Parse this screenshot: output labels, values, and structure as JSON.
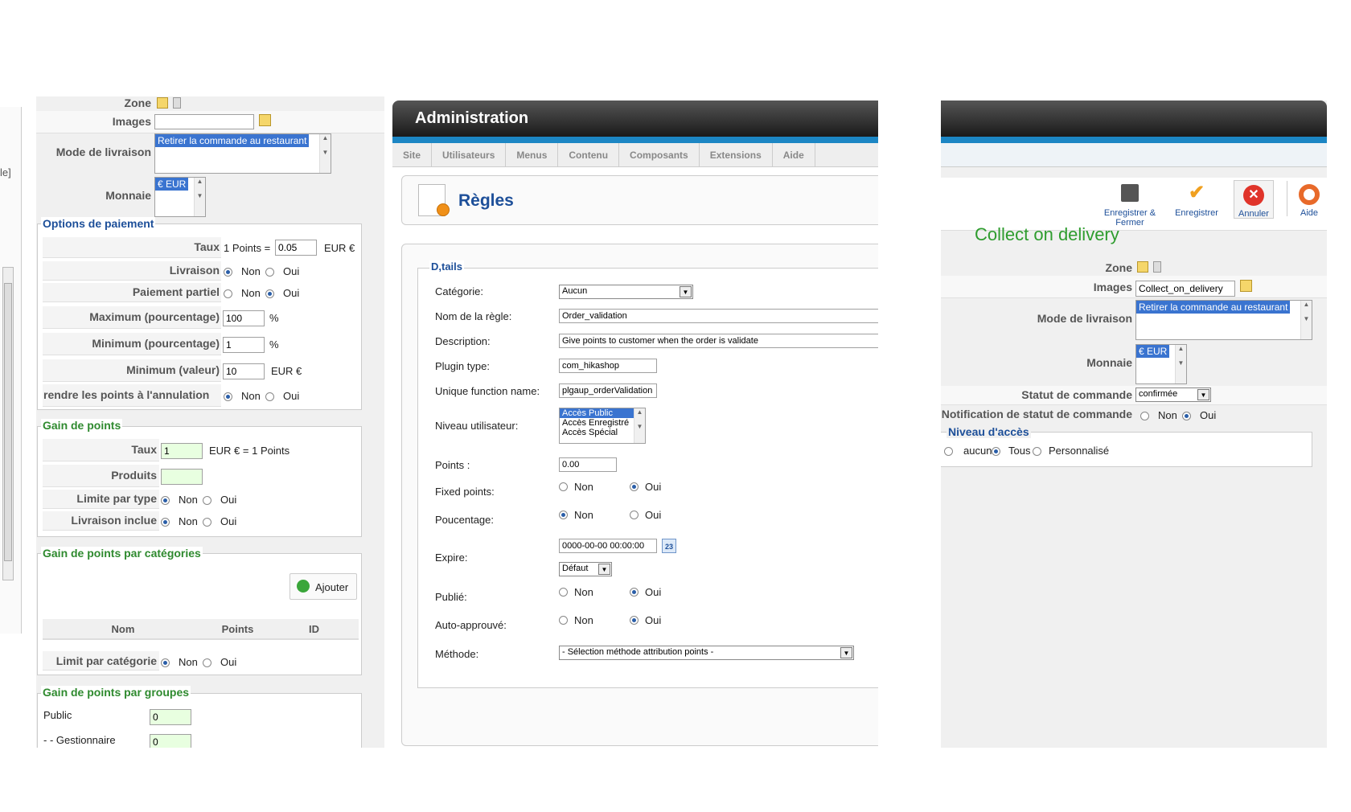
{
  "left": {
    "cut_text": "le]",
    "zone_label": "Zone",
    "images_label": "Images",
    "delivery_label": "Mode de livraison",
    "delivery_value": "Retirer la commande au restaurant",
    "currency_label": "Monnaie",
    "currency_value": "€ EUR",
    "payment": {
      "legend": "Options de paiement",
      "rate_label": "Taux",
      "rate_prefix": "1 Points =",
      "rate_value": "0.05",
      "rate_unit": "EUR €",
      "delivery_label": "Livraison",
      "partial_label": "Paiement partiel",
      "max_label": "Maximum (pourcentage)",
      "max_value": "100",
      "min_label": "Minimum (pourcentage)",
      "min_value": "1",
      "minval_label": "Minimum (valeur)",
      "minval_value": "10",
      "unit_pct": "%",
      "unit_eur": "EUR €",
      "refund_label": "rendre les points à l'annulation"
    },
    "gain": {
      "legend": "Gain de points",
      "rate_label": "Taux",
      "rate_value": "1",
      "rate_suffix": "EUR € = 1 Points",
      "products_label": "Produits",
      "limit_type_label": "Limite par type",
      "delivery_incl_label": "Livraison inclue"
    },
    "gain_cat": {
      "legend": "Gain de points par catégories",
      "add_label": "Ajouter",
      "col_name": "Nom",
      "col_points": "Points",
      "col_id": "ID",
      "limit_label": "Limit par catégorie"
    },
    "gain_groups": {
      "legend": "Gain de points par groupes",
      "public_label": "Public",
      "public_value": "0",
      "manager_label": "- - Gestionnaire",
      "manager_value": "0"
    },
    "non": "Non",
    "oui": "Oui"
  },
  "mid": {
    "header": "Administration",
    "tabs": [
      "Site",
      "Utilisateurs",
      "Menus",
      "Contenu",
      "Composants",
      "Extensions",
      "Aide"
    ],
    "title": "Règles",
    "legend": "D,tails",
    "category_label": "Catégorie:",
    "category_value": "Aucun",
    "name_label": "Nom de la règle:",
    "name_value": "Order_validation",
    "desc_label": "Description:",
    "desc_value": "Give points to customer when the order is validate",
    "plugin_label": "Plugin type:",
    "plugin_value": "com_hikashop",
    "func_label": "Unique function name:",
    "func_value": "plgaup_orderValidation",
    "level_label": "Niveau utilisateur:",
    "levels": [
      "Accès Public",
      "Accès Enregistré",
      "Accès Spécial"
    ],
    "points_label": "Points :",
    "points_value": "0.00",
    "fixed_label": "Fixed points:",
    "pct_label": "Poucentage:",
    "expire_label": "Expire:",
    "expire_value": "0000-00-00 00:00:00",
    "calendar_text": "23",
    "expire_default": "Défaut",
    "published_label": "Publié:",
    "auto_label": "Auto-approuvé:",
    "method_label": "Méthode:",
    "method_value": "- Sélection méthode attribution points -",
    "non": "Non",
    "oui": "Oui"
  },
  "right": {
    "tools": [
      "Enregistrer & Fermer",
      "Enregistrer",
      "Annuler",
      "Aide"
    ],
    "title": "Collect on delivery",
    "zone_label": "Zone",
    "images_label": "Images",
    "images_value": "Collect_on_delivery",
    "delivery_label": "Mode de livraison",
    "delivery_value": "Retirer la commande au restaurant",
    "currency_label": "Monnaie",
    "currency_value": "€ EUR",
    "status_label": "Statut de commande",
    "status_value": "confirmée",
    "notif_label": "Notification de statut de commande",
    "access_legend": "Niveau d'accès",
    "access_none": "aucun",
    "access_all": "Tous",
    "access_custom": "Personnalisé",
    "non": "Non",
    "oui": "Oui"
  }
}
